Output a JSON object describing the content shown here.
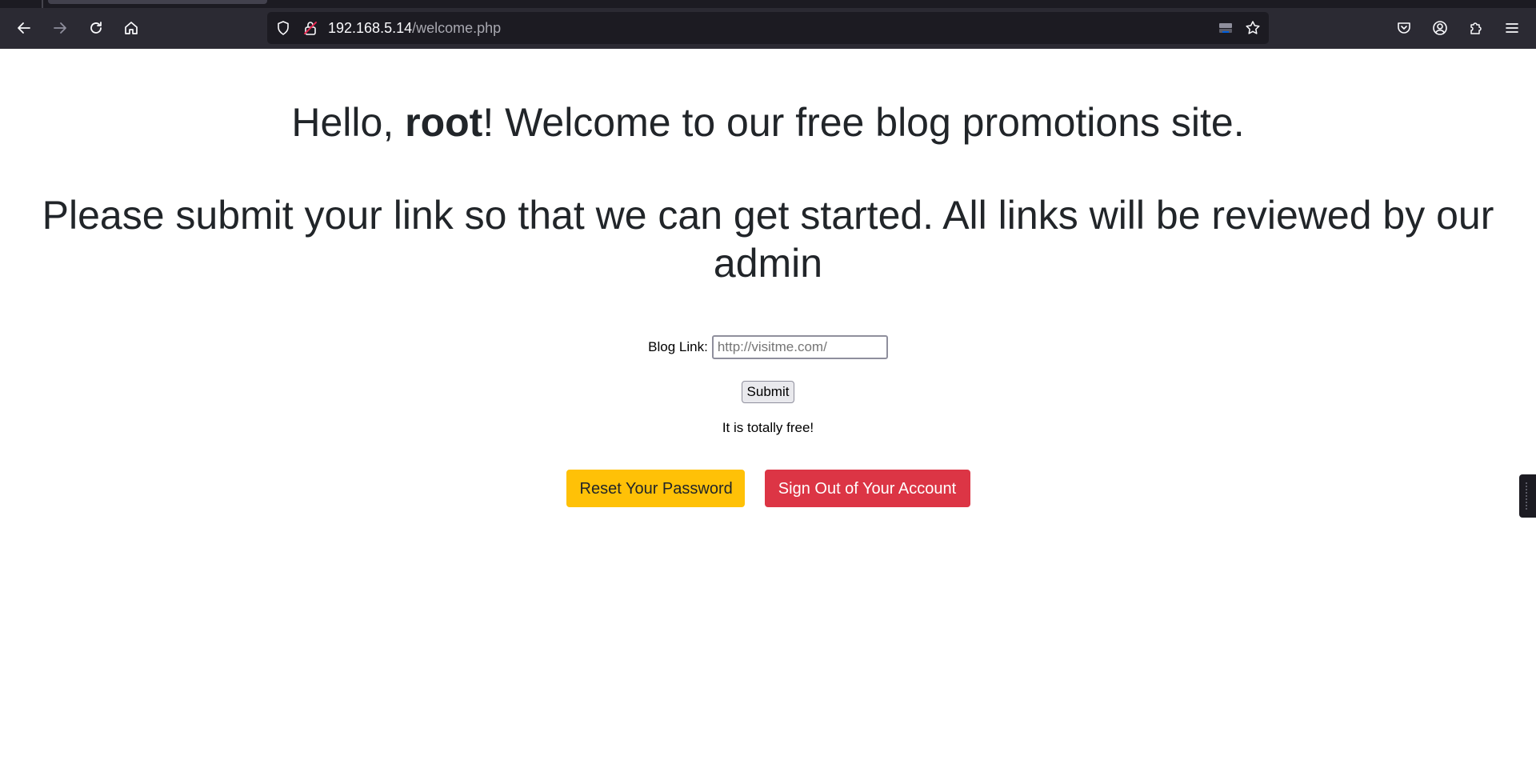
{
  "browser": {
    "url_host": "192.168.5.14",
    "url_path": "/welcome.php",
    "icons": {
      "back": "back-arrow-icon",
      "forward": "forward-arrow-icon",
      "reload": "reload-icon",
      "home": "home-icon",
      "tracking": "shield-icon",
      "insecure": "insecure-lock-icon",
      "reader": "reader-view-icon",
      "bookmark": "star-icon",
      "pocket": "pocket-icon",
      "account": "account-icon",
      "extensions": "puzzle-icon",
      "menu": "hamburger-menu-icon"
    }
  },
  "page": {
    "greeting_prefix": "Hello, ",
    "username": "root",
    "greeting_suffix": "! Welcome to our free blog promotions site.",
    "instructions": "Please submit your link so that we can get started. All links will be reviewed by our admin",
    "form": {
      "label": "Blog Link:",
      "placeholder": "http://visitme.com/",
      "value": "",
      "submit_label": "Submit"
    },
    "free_note": "It is totally free!",
    "reset_password_label": "Reset Your Password",
    "sign_out_label": "Sign Out of Your Account"
  },
  "colors": {
    "chrome_bg": "#2b2a33",
    "urlbar_bg": "#1c1b22",
    "text": "#212529",
    "warning": "#ffc107",
    "danger": "#dc3545"
  }
}
